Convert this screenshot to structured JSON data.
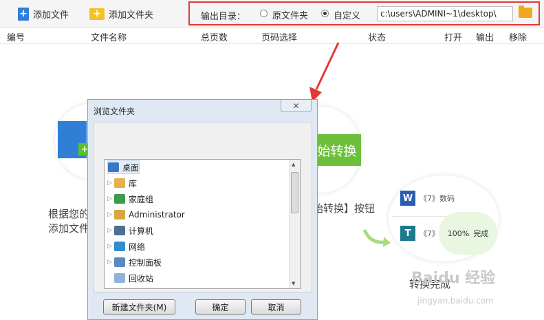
{
  "toolbar": {
    "add_file_label": "添加文件",
    "add_folder_label": "添加文件夹"
  },
  "output": {
    "label": "输出目录：",
    "option_original": "原文件夹",
    "option_custom": "自定义",
    "selected": "custom",
    "path_value": "c:\\users\\ADMINI~1\\desktop\\"
  },
  "columns": [
    "编号",
    "文件名称",
    "总页数",
    "页码选择",
    "状态",
    "打开",
    "输出",
    "移除"
  ],
  "background": {
    "start_button_text": "始转换",
    "caption_convert": "始转换】按钮",
    "caption_add_line1": "根据您的",
    "caption_add_line2": "添加文件",
    "file1": "《7》数码",
    "file2": "《7》",
    "progress_percent": "100%",
    "progress_status": "完成",
    "caption_done": "转换完成",
    "watermark": "Baidu 经验",
    "watermark_url": "jingyan.baidu.com"
  },
  "dialog": {
    "title": "浏览文件夹",
    "close_glyph": "✕",
    "tree": [
      {
        "label": "桌面",
        "icon": "desktop-icon",
        "expandable": false,
        "selected": true
      },
      {
        "label": "库",
        "icon": "library-icon",
        "expandable": true,
        "selected": false
      },
      {
        "label": "家庭组",
        "icon": "homegroup-icon",
        "expandable": true,
        "selected": false
      },
      {
        "label": "Administrator",
        "icon": "user-folder-icon",
        "expandable": true,
        "selected": false
      },
      {
        "label": "计算机",
        "icon": "computer-icon",
        "expandable": true,
        "selected": false
      },
      {
        "label": "网络",
        "icon": "network-icon",
        "expandable": true,
        "selected": false
      },
      {
        "label": "控制面板",
        "icon": "control-panel-icon",
        "expandable": true,
        "selected": false
      },
      {
        "label": "回收站",
        "icon": "recycle-bin-icon",
        "expandable": false,
        "selected": false
      }
    ],
    "new_folder_label": "新建文件夹(M)",
    "ok_label": "确定",
    "cancel_label": "取消"
  },
  "colors": {
    "highlight_box": "#e53935",
    "accent_green": "#6cbf3a",
    "word_blue": "#2a5db0"
  }
}
